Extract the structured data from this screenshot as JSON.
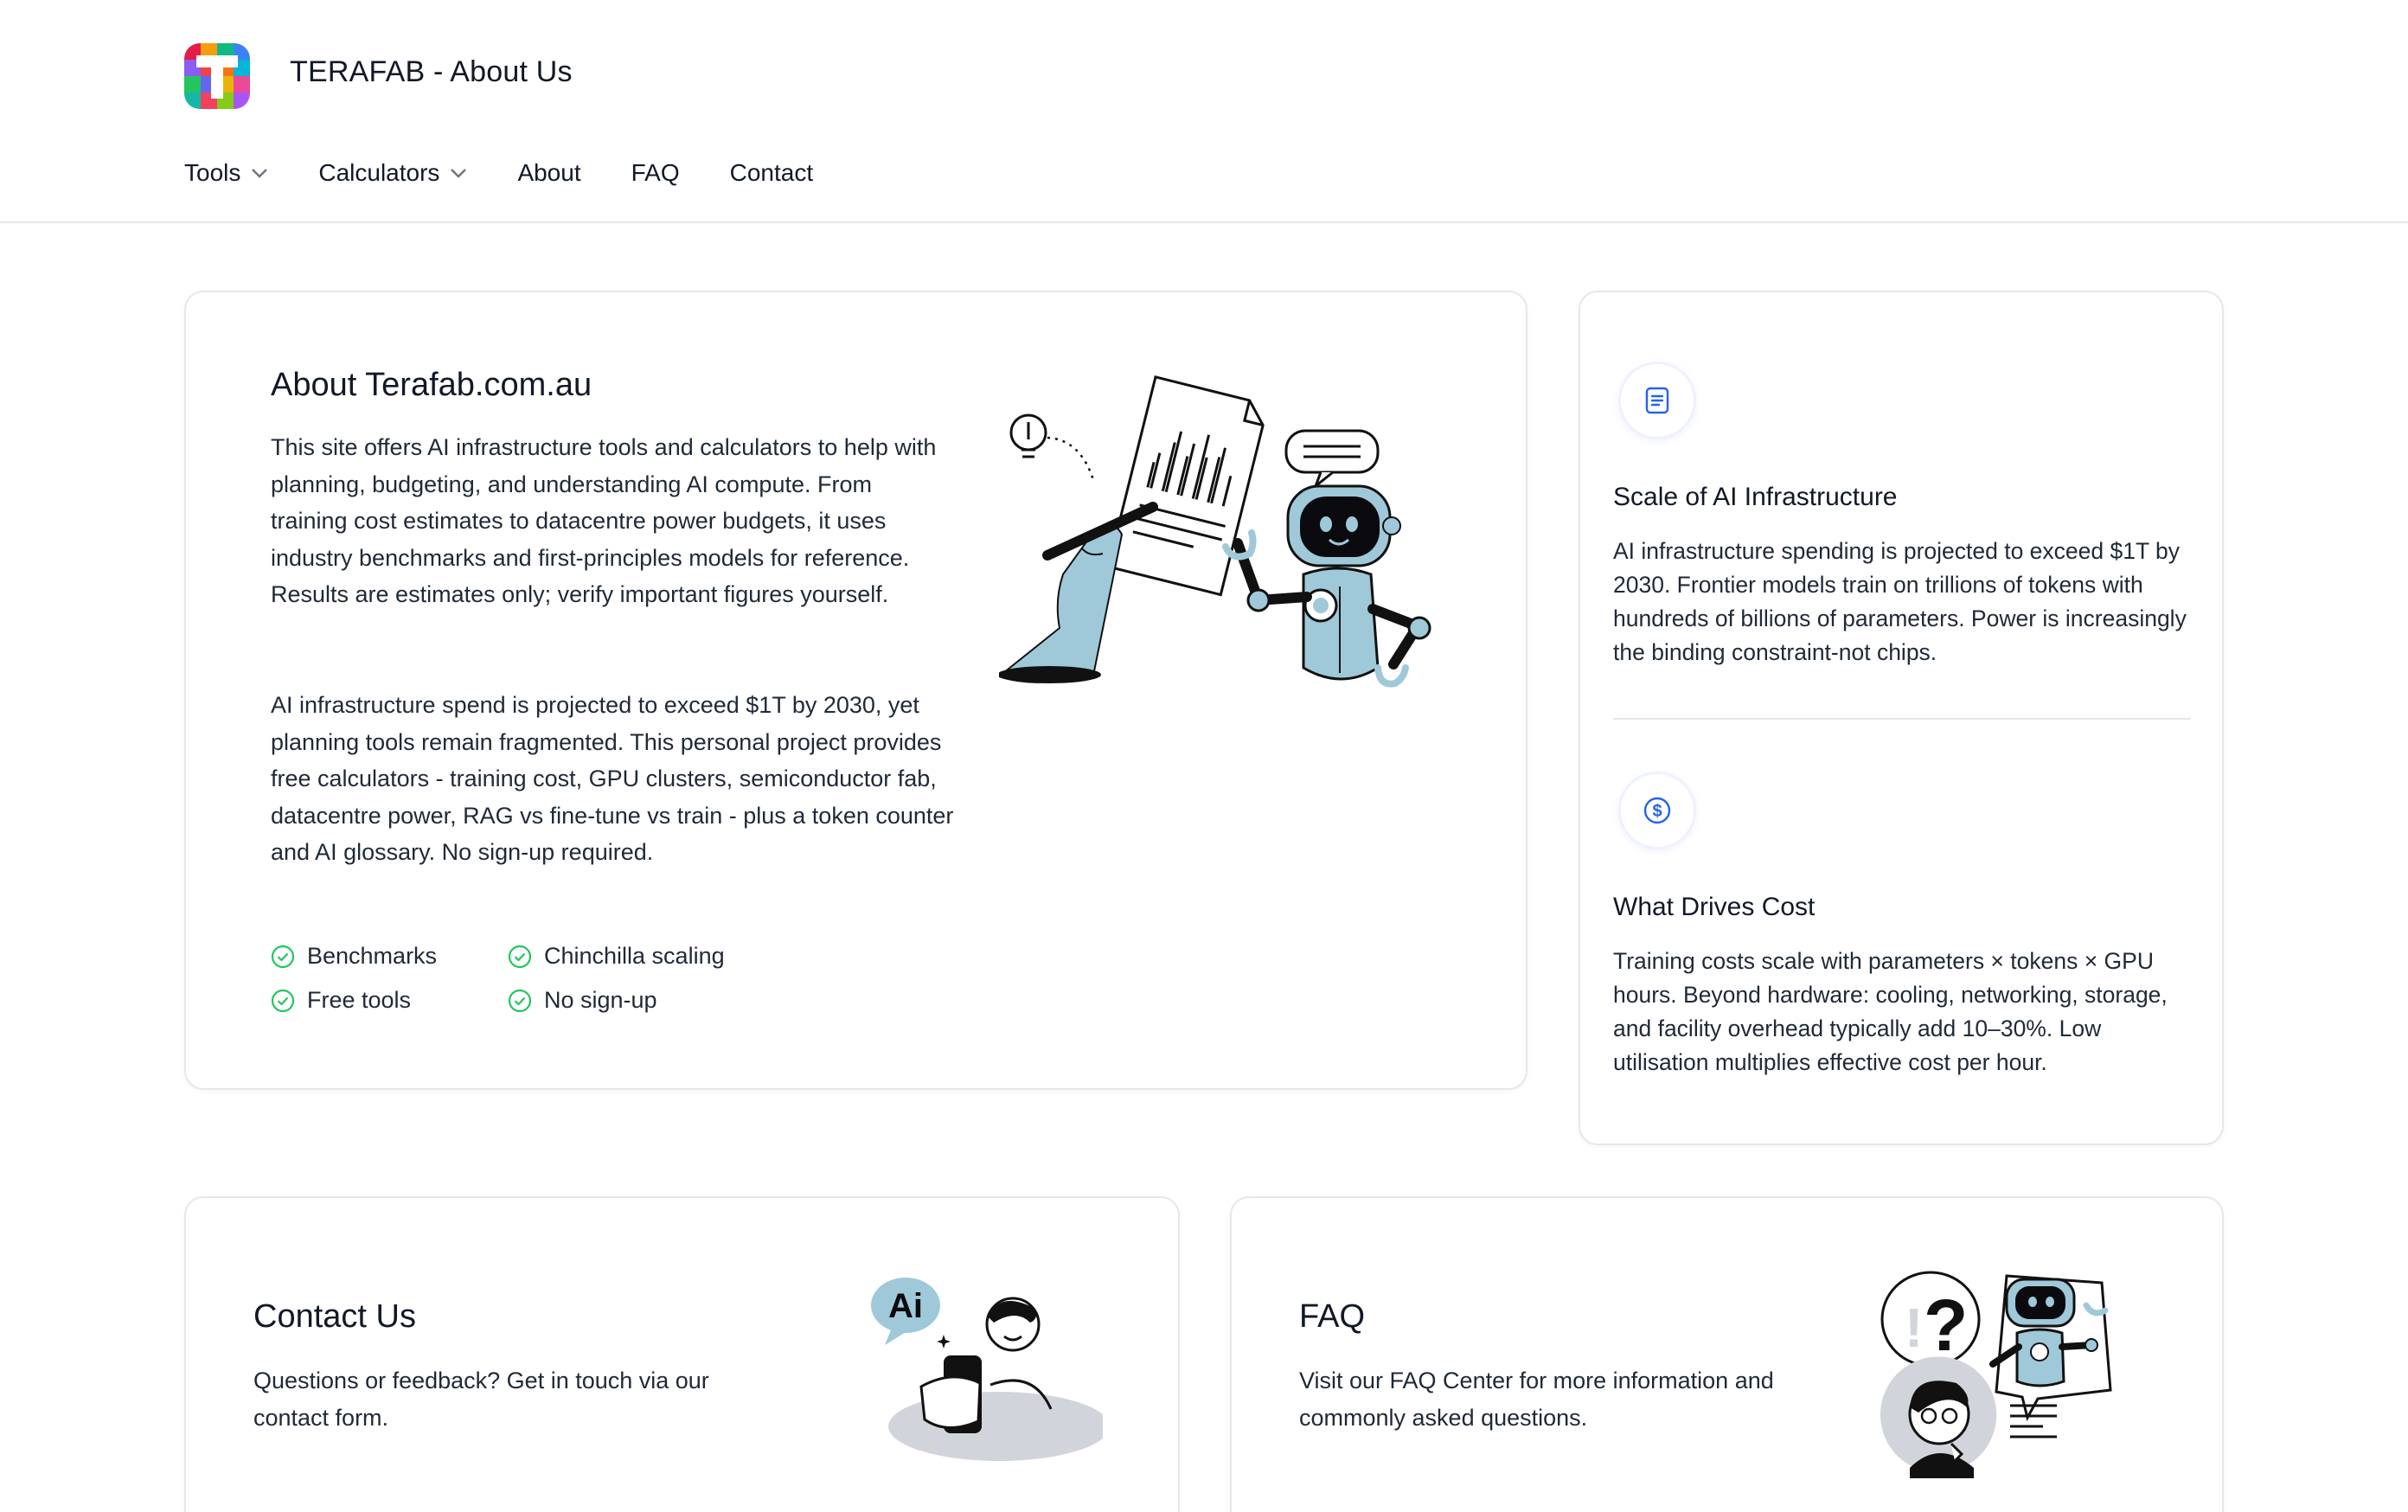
{
  "header": {
    "brand_title": "TERAFAB - About Us",
    "nav": [
      {
        "label": "Tools",
        "has_dropdown": true
      },
      {
        "label": "Calculators",
        "has_dropdown": true
      },
      {
        "label": "About",
        "has_dropdown": false
      },
      {
        "label": "FAQ",
        "has_dropdown": false
      },
      {
        "label": "Contact",
        "has_dropdown": false
      }
    ]
  },
  "about": {
    "title": "About Terafab.com.au",
    "paragraph1": "This site offers AI infrastructure tools and calculators to help with planning, budgeting, and understanding AI compute. From training cost estimates to datacentre power budgets, it uses industry benchmarks and first-principles models for reference. Results are estimates only; verify important figures yourself.",
    "paragraph2": "AI infrastructure spend is projected to exceed $1T by 2030, yet planning tools remain fragmented. This personal project provides free calculators - training cost, GPU clusters, semiconductor fab, datacentre power, RAG vs fine-tune vs train - plus a token counter and AI glossary. No sign-up required.",
    "features": [
      "Benchmarks",
      "Chinchilla scaling",
      "Free tools",
      "No sign-up"
    ]
  },
  "side": {
    "scale": {
      "icon": "document-icon",
      "title": "Scale of AI Infrastructure",
      "text": "AI infrastructure spending is projected to exceed $1T by 2030. Frontier models train on trillions of tokens with hundreds of billions of parameters. Power is increasingly the binding constraint-not chips."
    },
    "cost": {
      "icon": "dollar-icon",
      "title": "What Drives Cost",
      "text": "Training costs scale with parameters × tokens × GPU hours. Beyond hardware: cooling, networking, storage, and facility overhead typically add 10–30%. Low utilisation multiplies effective cost per hour."
    }
  },
  "contact": {
    "title": "Contact Us",
    "text": "Questions or feedback? Get in touch via our contact form.",
    "illustration_badge": "Ai"
  },
  "faq": {
    "title": "FAQ",
    "text": "Visit our FAQ Center for more information and commonly asked questions."
  },
  "colors": {
    "accent_blue": "#2563eb",
    "check_green": "#22c55e",
    "illustration_blue": "#9fc9d9",
    "border": "#e5e7eb"
  }
}
